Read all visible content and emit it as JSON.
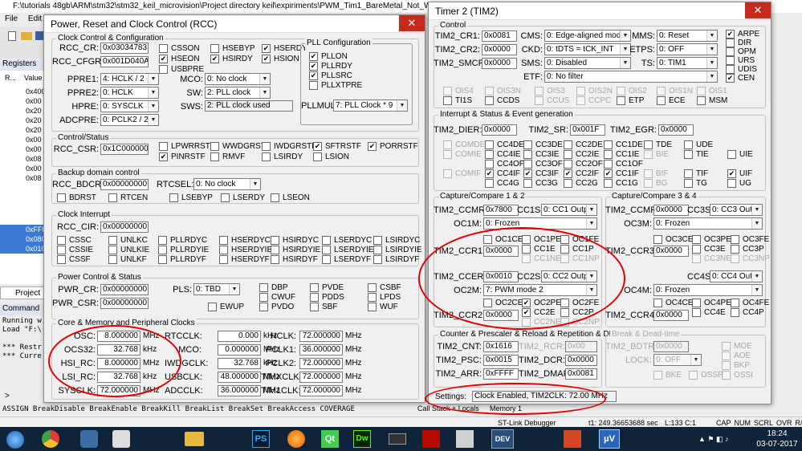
{
  "ide": {
    "title": "F:\\tutorials 48gb\\ARM\\stm32\\stm32_keil_microvision\\Project directory keil\\expiriments\\PWM_Tim1_BareMetal_Not_Working\\pwm.uv",
    "menu": [
      "File",
      "Edit"
    ],
    "registers_label": "Registers",
    "reg_col_r": "R...",
    "reg_col_value": "Value",
    "reg_values": [
      "0x400",
      "0x00",
      "0x20",
      "0x20",
      "0x20",
      "0x00",
      "0x00",
      "0x08",
      "0x00",
      "0x08"
    ],
    "reg_sel": [
      "0xFFF",
      "0x080",
      "0x010"
    ],
    "project_tab": "Project",
    "command_label": "Command",
    "cmd_lines": [
      "Running w",
      "Load \"F:\\",
      " ",
      "*** Restr",
      "*** Curre"
    ],
    "assign_line": "ASSIGN BreakDisable BreakEnable BreakKill BreakList BreakSet BreakAccess COVERAGE",
    "prompt": ">",
    "callstack_tab": "Call Stack + Locals",
    "memory_tab": "Memory 1",
    "status_debugger": "ST-Link Debugger",
    "status_time": "t1: 249.36653688 sec",
    "status_pos": "L:133 C:1",
    "status_flags": [
      "CAP",
      "NUM",
      "SCRL",
      "OVR",
      "R/W"
    ]
  },
  "rcc": {
    "title": "Power, Reset and Clock Control (RCC)",
    "close": "✕",
    "g_clock": "Clock Control & Configuration",
    "rcc_cr_label": "RCC_CR:",
    "rcc_cr": "0x03034783",
    "rcc_cfgr_label": "RCC_CFGR:",
    "rcc_cfgr": "0x001D040A",
    "cr_bits": [
      {
        "l": "CSSON",
        "c": false
      },
      {
        "l": "HSEON",
        "c": true
      },
      {
        "l": "USBPRE",
        "c": false
      },
      {
        "l": "HSEBYP",
        "c": false
      },
      {
        "l": "HSIRDY",
        "c": true
      },
      {
        "l": "HSERDY",
        "c": true
      },
      {
        "l": "HSION",
        "c": true
      }
    ],
    "ppre1_label": "PPRE1:",
    "ppre1": "4: HCLK / 2",
    "ppre2_label": "PPRE2:",
    "ppre2": "0: HCLK",
    "hpre_label": "HPRE:",
    "hpre": "0: SYSCLK",
    "adcpre_label": "ADCPRE:",
    "adcpre": "0: PCLK2 / 2",
    "mco_label": "MCO:",
    "mco": "0: No clock",
    "sw_label": "SW:",
    "sw": "2: PLL clock",
    "sws_label": "SWS:",
    "sws": "2: PLL clock used",
    "pll_label": "PLL Configuration",
    "pll_bits": [
      {
        "l": "PLLON",
        "c": true
      },
      {
        "l": "PLLRDY",
        "c": true
      },
      {
        "l": "PLLSRC",
        "c": true
      },
      {
        "l": "PLLXTPRE",
        "c": false
      }
    ],
    "pllmul_label": "PLLMUL:",
    "pllmul": "7: PLL Clock * 9",
    "g_status": "Control/Status",
    "rcc_csr_label": "RCC_CSR:",
    "rcc_csr": "0x1C000000",
    "csr_bits": [
      {
        "l": "LPWRRSTF",
        "c": false
      },
      {
        "l": "PINRSTF",
        "c": true
      },
      {
        "l": "WWDGRSTF",
        "c": false
      },
      {
        "l": "RMVF",
        "c": false
      },
      {
        "l": "IWDGRSTF",
        "c": false
      },
      {
        "l": "LSIRDY",
        "c": false
      },
      {
        "l": "SFTRSTF",
        "c": true
      },
      {
        "l": "LSION",
        "c": false
      },
      {
        "l": "PORRSTF",
        "c": true
      }
    ],
    "g_backup": "Backup domain control",
    "rcc_bdcr_label": "RCC_BDCR:",
    "rcc_bdcr": "0x00000000",
    "rtcsel_label": "RTCSEL:",
    "rtcsel": "0: No clock",
    "bdcr_bits": [
      {
        "l": "BDRST",
        "c": false
      },
      {
        "l": "RTCEN",
        "c": false
      },
      {
        "l": "LSEBYP",
        "c": false
      },
      {
        "l": "LSERDY",
        "c": false
      },
      {
        "l": "LSEON",
        "c": false
      }
    ],
    "g_int": "Clock Interrupt",
    "rcc_cir_label": "RCC_CIR:",
    "rcc_cir": "0x00000000",
    "cir_bits": [
      [
        "CSSC",
        "UNLKC",
        "PLLRDYC",
        "HSERDYC",
        "HSIRDYC",
        "LSERDYC",
        "LSIRDYC"
      ],
      [
        "CSSIE",
        "UNLKIE",
        "PLLRDYIE",
        "HSERDYIE",
        "HSIRDYIE",
        "LSERDYIE",
        "LSIRDYIE"
      ],
      [
        "CSSF",
        "UNLKF",
        "PLLRDYF",
        "HSERDYF",
        "HSIRDYF",
        "LSERDYF",
        "LSIRDYF"
      ]
    ],
    "g_power": "Power Control & Status",
    "pwr_cr_label": "PWR_CR:",
    "pwr_cr": "0x00000000",
    "pwr_csr_label": "PWR_CSR:",
    "pwr_csr": "0x00000000",
    "pls_label": "PLS:",
    "pls": "0: TBD",
    "pwr_bits": [
      {
        "l": "DBP",
        "c": false
      },
      {
        "l": "CWUF",
        "c": false
      },
      {
        "l": "PVDO",
        "c": false
      },
      {
        "l": "PVDE",
        "c": false
      },
      {
        "l": "PDDS",
        "c": false
      },
      {
        "l": "SBF",
        "c": false
      },
      {
        "l": "CSBF",
        "c": false
      },
      {
        "l": "LPDS",
        "c": false
      },
      {
        "l": "WUF",
        "c": false
      },
      {
        "l": "EWUP",
        "c": false
      }
    ],
    "g_core": "Core & Memory and Peripheral Clocks",
    "clk_col1": [
      {
        "l": "OSC:",
        "v": "8.000000",
        "u": "MHz"
      },
      {
        "l": "OCS32:",
        "v": "32.768",
        "u": "kHz"
      },
      {
        "l": "HSI_RC:",
        "v": "8.000000",
        "u": "MHz"
      },
      {
        "l": "LSI_RC:",
        "v": "32.768",
        "u": "kHz"
      },
      {
        "l": "SYSCLK:",
        "v": "72.000000",
        "u": "MHz"
      }
    ],
    "clk_col2": [
      {
        "l": "RTCCLK:",
        "v": "0.000",
        "u": "kHz"
      },
      {
        "l": "MCO:",
        "v": "0.000000",
        "u": "MHz"
      },
      {
        "l": "IWDGCLK:",
        "v": "32.768",
        "u": "kHz"
      },
      {
        "l": "USBCLK:",
        "v": "48.000000",
        "u": "MHz"
      },
      {
        "l": "ADCCLK:",
        "v": "36.000000",
        "u": "MHz"
      }
    ],
    "clk_col3": [
      {
        "l": "HCLK:",
        "v": "72.000000",
        "u": "MHz"
      },
      {
        "l": "PCLK1:",
        "v": "36.000000",
        "u": "MHz"
      },
      {
        "l": "PCLK2:",
        "v": "72.000000",
        "u": "MHz"
      },
      {
        "l": "TIMXCLK:",
        "v": "72.000000",
        "u": "MHz"
      },
      {
        "l": "TIM1CLK:",
        "v": "72.000000",
        "u": "MHz"
      }
    ]
  },
  "tim2": {
    "title": "Timer 2 (TIM2)",
    "close": "✕",
    "g_control": "Control",
    "cr1_label": "TIM2_CR1:",
    "cr1": "0x0081",
    "cr2_label": "TIM2_CR2:",
    "cr2": "0x0000",
    "smcr_label": "TIM2_SMCR:",
    "smcr": "0x0000",
    "cms_label": "CMS:",
    "cms": "0: Edge-aligned mode",
    "ckd_label": "CKD:",
    "ckd": "0: tDTS = tCK_INT",
    "sms_label": "SMS:",
    "sms": "0: Disabled",
    "etf_label": "ETF:",
    "etf": "0:  No filter",
    "mms_label": "MMS:",
    "mms": "0: Reset",
    "etps_label": "ETPS:",
    "etps": "0: OFF",
    "ts_label": "TS:",
    "ts": "0: TIM1",
    "cr_bits": [
      {
        "l": "ARPE",
        "c": true
      },
      {
        "l": "DIR",
        "c": false
      },
      {
        "l": "OPM",
        "c": false
      },
      {
        "l": "URS",
        "c": false
      },
      {
        "l": "UDIS",
        "c": false
      },
      {
        "l": "CEN",
        "c": true
      }
    ],
    "ctrl_row1": [
      "OIS4",
      "OIS3N",
      "OIS3",
      "OIS2N",
      "OIS2",
      "OIS1N",
      "OIS1"
    ],
    "ctrl_row2": [
      {
        "l": "TI1S",
        "d": false
      },
      {
        "l": "CCDS",
        "d": false
      },
      {
        "l": "CCUS",
        "d": true
      },
      {
        "l": "CCPC",
        "d": true
      },
      {
        "l": "ETP",
        "d": false
      },
      {
        "l": "ECE",
        "d": false
      },
      {
        "l": "MSM",
        "d": false
      }
    ],
    "g_int": "Interrupt & Status & Event generation",
    "dier_label": "TIM2_DIER:",
    "dier": "0x0000",
    "sr_label": "TIM2_SR:",
    "sr": "0x001F",
    "egr_label": "TIM2_EGR:",
    "egr": "0x0000",
    "int_rows": [
      [
        {
          "l": "COMDE",
          "d": true
        },
        {
          "l": "CC4DE",
          "d": false
        },
        {
          "l": "CC3DE",
          "d": false
        },
        {
          "l": "CC2DE",
          "d": false
        },
        {
          "l": "CC1DE",
          "d": false
        },
        {
          "l": "TDE",
          "d": false
        },
        {
          "l": "UDE",
          "d": false
        }
      ],
      [
        {
          "l": "COMIE",
          "d": true
        },
        {
          "l": "CC4IE",
          "d": false
        },
        {
          "l": "CC3IE",
          "d": false
        },
        {
          "l": "CC2IE",
          "d": false
        },
        {
          "l": "CC1IE",
          "d": false
        },
        {
          "l": "BIE",
          "d": true
        },
        {
          "l": "TIE",
          "d": false
        },
        {
          "l": "UIE",
          "d": false
        }
      ],
      [
        {
          "l": "CC4OF",
          "d": false
        },
        {
          "l": "CC3OF",
          "d": false
        },
        {
          "l": "CC2OF",
          "d": false
        },
        {
          "l": "CC1OF",
          "d": false
        }
      ],
      [
        {
          "l": "COMIF",
          "d": true
        },
        {
          "l": "CC4IF",
          "d": false,
          "c": true
        },
        {
          "l": "CC3IF",
          "d": false,
          "c": true
        },
        {
          "l": "CC2IF",
          "d": false,
          "c": true
        },
        {
          "l": "CC1IF",
          "d": false,
          "c": true
        },
        {
          "l": "BIF",
          "d": true
        },
        {
          "l": "TIF",
          "d": false
        },
        {
          "l": "UIF",
          "d": false,
          "c": true
        }
      ],
      [
        {
          "l": "CC4G",
          "d": false
        },
        {
          "l": "CC3G",
          "d": false
        },
        {
          "l": "CC2G",
          "d": false
        },
        {
          "l": "CC1G",
          "d": false
        },
        {
          "l": "BG",
          "d": true
        },
        {
          "l": "TG",
          "d": false
        },
        {
          "l": "UG",
          "d": false
        }
      ]
    ],
    "g_cc12": "Capture/Compare 1 & 2",
    "ccmr1_label": "TIM2_CCMR1:",
    "ccmr1": "0x7800",
    "cc1s_label": "CC1S:",
    "cc1s": "0: CC1 Output",
    "oc1m_label": "OC1M:",
    "oc1m": "0: Frozen",
    "ccr1_label": "TIM2_CCR1:",
    "ccr1": "0x0000",
    "oc1_bits": [
      {
        "l": "OC1CE",
        "d": false
      },
      {
        "l": "OC1PE",
        "d": false
      },
      {
        "l": "OC1FE",
        "d": false
      },
      {
        "l": "CC1E",
        "d": false
      },
      {
        "l": "CC1P",
        "d": false
      },
      {
        "l": "CC1NE",
        "d": true
      },
      {
        "l": "CC1NP",
        "d": true
      }
    ],
    "ccer_label": "TIM2_CCER:",
    "ccer": "0x0010",
    "cc2s_label": "CC2S:",
    "cc2s": "0: CC2 Output",
    "oc2m_label": "OC2M:",
    "oc2m": "7: PWM mode 2",
    "ccr2_label": "TIM2_CCR2:",
    "ccr2": "0x0000",
    "oc2_bits": [
      {
        "l": "OC2CE",
        "d": false
      },
      {
        "l": "OC2PE",
        "d": false,
        "c": true
      },
      {
        "l": "OC2FE",
        "d": false
      },
      {
        "l": "CC2E",
        "d": false,
        "c": true
      },
      {
        "l": "CC2P",
        "d": false
      },
      {
        "l": "CC2NE",
        "d": true
      },
      {
        "l": "CC2NP",
        "d": true
      }
    ],
    "g_cc34": "Capture/Compare 3 & 4",
    "ccmr2_label": "TIM2_CCMR2:",
    "ccmr2": "0x0000",
    "cc3s_label": "CC3S:",
    "cc3s": "0: CC3 Output",
    "oc3m_label": "OC3M:",
    "oc3m": "0: Frozen",
    "ccr3_label": "TIM2_CCR3:",
    "ccr3": "0x0000",
    "oc3_bits": [
      {
        "l": "OC3CE",
        "d": false
      },
      {
        "l": "OC3PE",
        "d": false
      },
      {
        "l": "OC3FE",
        "d": false
      },
      {
        "l": "CC3E",
        "d": false
      },
      {
        "l": "CC3P",
        "d": false
      },
      {
        "l": "CC3NE",
        "d": true
      },
      {
        "l": "CC3NP",
        "d": true
      }
    ],
    "cc4s_label": "CC4S:",
    "cc4s": "0: CC4 Output",
    "oc4m_label": "OC4M:",
    "oc4m": "0: Frozen",
    "ccr4_label": "TIM2_CCR4:",
    "ccr4": "0x0000",
    "oc4_bits": [
      {
        "l": "OC4CE",
        "d": false
      },
      {
        "l": "OC4PE",
        "d": false
      },
      {
        "l": "OC4FE",
        "d": false
      },
      {
        "l": "CC4E",
        "d": false
      },
      {
        "l": "CC4P",
        "d": false
      }
    ],
    "g_counter": "Counter & Prescaler & Reload & Repetition & DMA",
    "cnt_label": "TIM2_CNT:",
    "cnt": "0x1616",
    "psc_label": "TIM2_PSC:",
    "psc": "0x0015",
    "arr_label": "TIM2_ARR:",
    "arr": "0xFFFF",
    "rcr_label": "TIM2_RCR:",
    "rcr": "0x00",
    "dcr_label": "TIM2_DCR:",
    "dcr": "0x0000",
    "dmar_label": "TIM2_DMAR:",
    "dmar": "0x0081",
    "g_break": "Break & Dead-time",
    "bdtr_label": "TIM2_BDTR:",
    "bdtr": "0x0000",
    "lock_label": "LOCK:",
    "lock": "0: OFF",
    "break_bits": [
      "MOE",
      "AOE",
      "BKP",
      "OSSI",
      "BKE",
      "OSSR"
    ],
    "settings_label": "Settings:",
    "settings": "Clock Enabled, TIM2CLK: 72.00 MHz"
  },
  "taskbar": {
    "time": "18:24",
    "date": "03-07-2017",
    "apps": [
      "PS",
      "Qt",
      "Dw",
      "DEV",
      "μV"
    ]
  },
  "colors": {
    "annotation": "#e00000",
    "desktop": "#1e4f8a",
    "window_bg": "#f0f0f0",
    "close_red": "#c42b1c",
    "taskbar": "#0f2438"
  }
}
